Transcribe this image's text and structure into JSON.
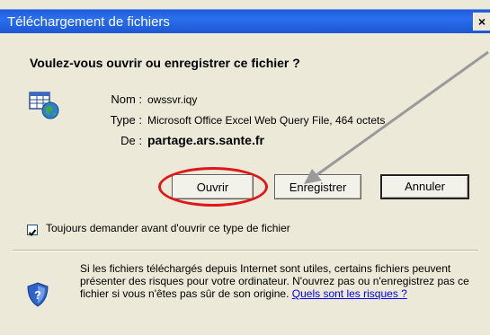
{
  "window": {
    "title": "Téléchargement de fichiers",
    "close_symbol": "×"
  },
  "dialog": {
    "question": "Voulez-vous ouvrir ou enregistrer ce fichier ?",
    "fields": [
      {
        "label": "Nom :",
        "value": "owssvr.iqy"
      },
      {
        "label": "Type :",
        "value": "Microsoft Office Excel Web Query File, 464 octets"
      },
      {
        "label": "De :",
        "value": "partage.ars.sante.fr"
      }
    ],
    "buttons": {
      "open": "Ouvrir",
      "save": "Enregistrer",
      "cancel": "Annuler"
    },
    "checkbox": {
      "label": "Toujours demander avant d'ouvrir ce type de fichier",
      "checked": true
    },
    "info": {
      "text": "Si les fichiers téléchargés depuis Internet sont utiles, certains fichiers peuvent présenter des risques pour votre ordinateur. N'ouvrez pas ou n'enregistrez pas ce fichier si vous n'êtes pas sûr de son origine.",
      "link": "Quels sont les risques ?"
    }
  },
  "annotations": {
    "highlight_color": "#e0171a",
    "arrow_color": "#9a9a9a"
  },
  "icons": {
    "file": "web-query-file-icon",
    "security": "security-shield-icon"
  }
}
